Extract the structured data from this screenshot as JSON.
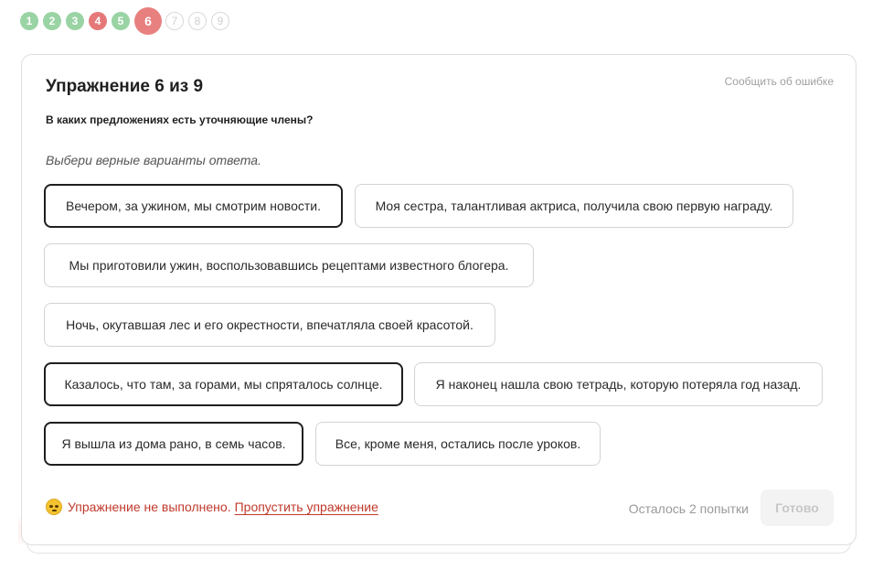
{
  "progress": {
    "steps": [
      {
        "label": "1",
        "state": "done"
      },
      {
        "label": "2",
        "state": "done"
      },
      {
        "label": "3",
        "state": "done"
      },
      {
        "label": "4",
        "state": "fail"
      },
      {
        "label": "5",
        "state": "done"
      },
      {
        "label": "6",
        "state": "active"
      },
      {
        "label": "7",
        "state": "todo"
      },
      {
        "label": "8",
        "state": "todo"
      },
      {
        "label": "9",
        "state": "todo"
      }
    ]
  },
  "exercise": {
    "title": "Упражнение 6 из 9",
    "report_link": "Сообщить об ошибке",
    "question": "В каких предложениях есть уточняющие члены?",
    "hint": "Выбери верные варианты ответа.",
    "options": [
      {
        "text": "Вечером, за ужином, мы смотрим новости.",
        "selected": true
      },
      {
        "text": "Моя сестра, талантливая актриса, получила свою первую награду.",
        "selected": false
      },
      {
        "text": "Мы приготовили ужин, воспользовавшись рецептами известного блогера.",
        "selected": false
      },
      {
        "text": "Ночь, окутавшая лес и его окрестности, впечатляла своей красотой.",
        "selected": false
      },
      {
        "text": "Казалось, что там, за горами, мы спряталось солнце.",
        "selected": true
      },
      {
        "text": "Я наконец нашла свою тетрадь, которую потеряла год назад.",
        "selected": false
      },
      {
        "text": "Я вышла из дома рано, в семь часов.",
        "selected": true
      },
      {
        "text": "Все, кроме меня, остались после уроков.",
        "selected": false
      }
    ]
  },
  "footer": {
    "status_text": "Упражнение не выполнено.",
    "skip_link": "Пропустить упражнение",
    "attempts_left": "Осталось 2 попытки",
    "done_button": "Готово"
  },
  "colors": {
    "step_done": "#9ad3a4",
    "step_fail": "#e57878",
    "step_active": "#e88080",
    "error_text": "#c0392b"
  }
}
